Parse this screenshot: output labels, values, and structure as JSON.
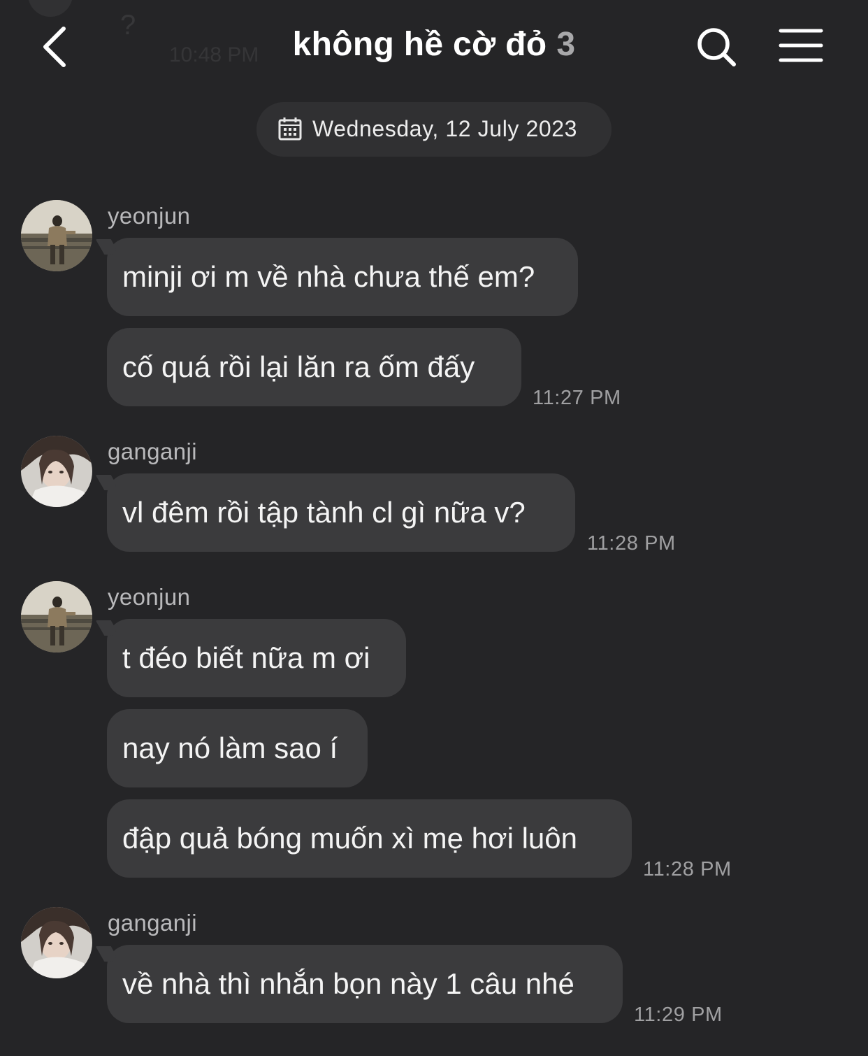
{
  "ghost": {
    "question_mark": "?",
    "time": "10:48 PM"
  },
  "header": {
    "title": "không hề cờ đỏ",
    "member_count": "3",
    "back_icon": "chevron-left-icon",
    "search_icon": "search-icon",
    "menu_icon": "hamburger-menu-icon"
  },
  "date_divider": {
    "icon": "calendar-icon",
    "text": "Wednesday, 12 July 2023"
  },
  "groups": [
    {
      "sender": "yeonjun",
      "messages": [
        "minji ơi m về nhà chưa thế em?",
        "cố quá rồi lại lăn ra ốm đấy"
      ],
      "time": "11:27 PM"
    },
    {
      "sender": "ganganji",
      "messages": [
        "vl đêm rồi tập tành cl gì nữa v?"
      ],
      "time": "11:28 PM"
    },
    {
      "sender": "yeonjun",
      "messages": [
        "t đéo biết nữa m ơi",
        "nay nó làm sao í",
        "đập quả bóng muốn xì mẹ hơi luôn"
      ],
      "time": "11:28 PM"
    },
    {
      "sender": "ganganji",
      "messages": [
        "về nhà thì nhắn bọn này 1 câu nhé"
      ],
      "time": "11:29 PM"
    }
  ],
  "colors": {
    "background": "#252527",
    "bubble": "#3b3b3d",
    "date_pill": "#303032",
    "muted_text": "#a0a0a2"
  }
}
